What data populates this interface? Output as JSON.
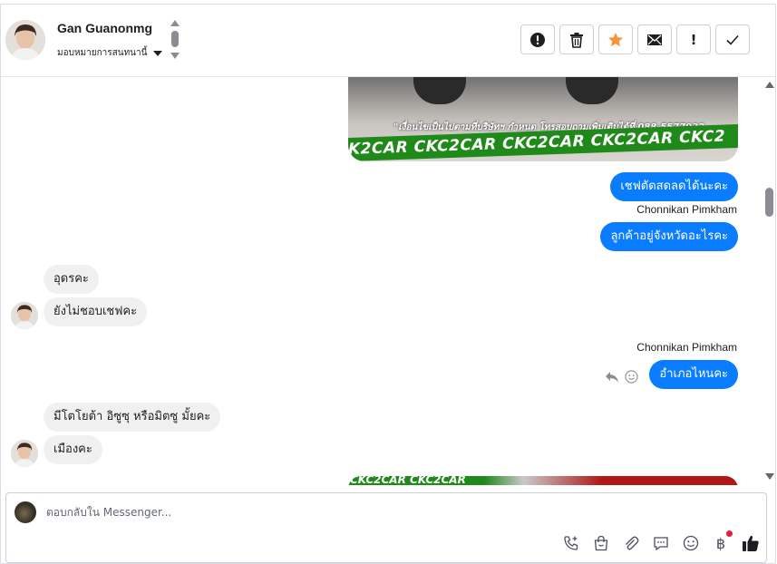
{
  "header": {
    "contact_name": "Gan Guanonmg",
    "assign_label": "มอบหมายการสนทนานี้"
  },
  "actions": [
    {
      "name": "spam-button",
      "icon": "alert-circle-icon"
    },
    {
      "name": "delete-button",
      "icon": "trash-icon"
    },
    {
      "name": "star-button",
      "icon": "star-icon",
      "color": "#f7923b"
    },
    {
      "name": "email-button",
      "icon": "envelope-icon"
    },
    {
      "name": "follow-up-button",
      "icon": "exclamation-icon",
      "glyph": "!"
    },
    {
      "name": "mark-done-button",
      "icon": "check-icon"
    }
  ],
  "conversation": {
    "image_top": {
      "caption": "\"เงื่อนไขเป็นไปตามที่บริษัทฯ กำหนด โทรสอบถามเพิ่มเติมได้ที่ 088-5577932",
      "band_text": "K2CAR CKC2CAR CKC2CAR CKC2CAR CKC2"
    },
    "messages": [
      {
        "id": "m1",
        "direction": "out",
        "text": "เชฟตัดสดลดได้นะคะ"
      },
      {
        "id": "m2",
        "direction": "out",
        "sender": "Chonnikan Pimkham",
        "text": "ลูกค้าอยู่จังหวัดอะไรคะ"
      },
      {
        "id": "m3",
        "direction": "in",
        "text": "อุดรคะ"
      },
      {
        "id": "m4",
        "direction": "in",
        "text": "ยังไม่ชอบเชฟคะ"
      },
      {
        "id": "m5",
        "direction": "out",
        "sender": "Chonnikan Pimkham",
        "text": "อำเภอไหนคะ"
      },
      {
        "id": "m6",
        "direction": "in",
        "text": "มีโตโยต้า อิซูซุ หรือมิตซู มั้ยคะ"
      },
      {
        "id": "m7",
        "direction": "in",
        "text": "เมืองคะ"
      }
    ],
    "image_bottom": {
      "band_text": "CKC2CAR CKC2CAR"
    }
  },
  "composer": {
    "placeholder": "ตอบกลับใน Messenger...",
    "tools": [
      "phone-plus-icon",
      "shopping-bag-icon",
      "paperclip-icon",
      "saved-reply-icon",
      "emoji-icon",
      "baht-icon",
      "thumbs-up-icon"
    ],
    "baht_symbol": "฿",
    "accent": "#0a7cff"
  }
}
